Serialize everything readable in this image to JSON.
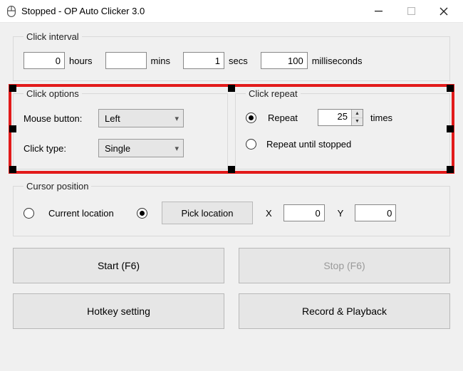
{
  "window": {
    "title": "Stopped - OP Auto Clicker 3.0"
  },
  "interval": {
    "legend": "Click interval",
    "hours_value": "0",
    "hours_label": "hours",
    "mins_value": "",
    "mins_label": "mins",
    "secs_value": "1",
    "secs_label": "secs",
    "ms_value": "100",
    "ms_label": "milliseconds"
  },
  "options": {
    "legend": "Click options",
    "mouse_label": "Mouse button:",
    "mouse_value": "Left",
    "type_label": "Click type:",
    "type_value": "Single"
  },
  "repeat": {
    "legend": "Click repeat",
    "repeat_label": "Repeat",
    "repeat_value": "25",
    "times_label": "times",
    "until_label": "Repeat until stopped"
  },
  "cursor": {
    "legend": "Cursor position",
    "current_label": "Current location",
    "pick_label": "Pick location",
    "x_label": "X",
    "x_value": "0",
    "y_label": "Y",
    "y_value": "0"
  },
  "buttons": {
    "start": "Start (F6)",
    "stop": "Stop (F6)",
    "hotkey": "Hotkey setting",
    "record": "Record & Playback"
  }
}
